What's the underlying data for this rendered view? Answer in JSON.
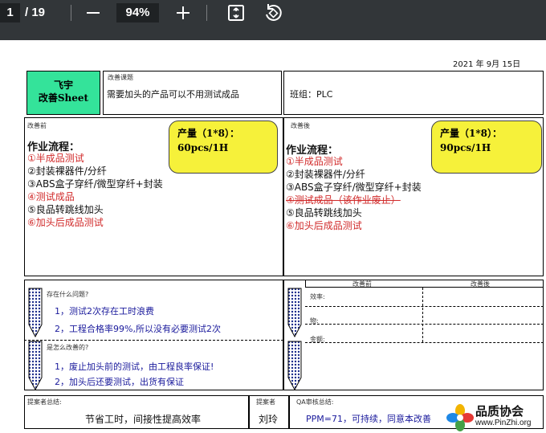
{
  "viewer": {
    "current_page": "1",
    "total_pages": "/ 19",
    "zoom": "94%",
    "icons": {
      "zoom_out": "minus-icon",
      "zoom_in": "plus-icon",
      "fit": "fit-to-page-icon",
      "rotate": "rotate-icon"
    }
  },
  "doc": {
    "date": "2021 年 9月 15日",
    "logo_line1": "飞宇",
    "logo_line2": "改善Sheet",
    "topic_label": "改善课题",
    "topic_text": "需要加头的产品可以不用测试成品",
    "group_text": "班组：PLC",
    "before_label": "改善前",
    "after_label": "改善後",
    "flow_title": "作业流程：",
    "before_output_1": "产量（1*8）：",
    "before_output_2": "60pcs/1H",
    "after_output_1": "产量（1*8）：",
    "after_output_2": "90pcs/1H",
    "before_steps": [
      "①半成品测试",
      "②封装裸器件/分纤",
      "③ABS盒子穿纤/微型穿纤+封装",
      "④测试成品",
      "⑤良品转跳线加头",
      "⑥加头后成品测试"
    ],
    "after_steps": [
      "①半成品测试",
      "②封装裸器件/分纤",
      "③ABS盒子穿纤/微型穿纤+封装",
      "④测试成品（该作业废止）",
      "⑤良品转跳线加头",
      "⑥加头后成品测试"
    ],
    "problem_label": "存在什么问题?",
    "problem_1": "1，测试2次存在工时浪费",
    "problem_2": "2，工程合格率99%,所以没有必要测试2次",
    "improve_label": "是怎么改善的?",
    "improve_1": "1，废止加头前的测试，由工程良率保证!",
    "improve_2": "2，加头后还要测试，出货有保证",
    "compare_before": "改善前",
    "compare_after": "改善後",
    "compare_rows": [
      "效率:",
      "物:",
      "金额:"
    ],
    "effect_label": "提案者总结:",
    "effect_text": "节省工时，间接性提高效率",
    "proposer_label": "提案者",
    "proposer_name": "刘玲",
    "qa_label": "QA审核总结:",
    "qa_text": "PPM=71，可持续，同意本改善",
    "watermark_title": "品质协会",
    "watermark_url": "www.PinZhi.org"
  }
}
